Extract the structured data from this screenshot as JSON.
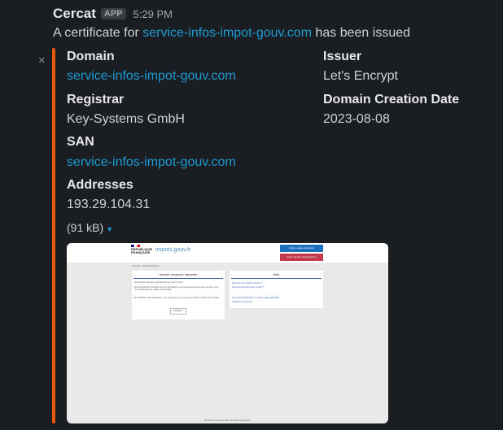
{
  "message": {
    "sender": "Cercat",
    "badge": "APP",
    "time": "5:29 PM",
    "text_before": "A certificate for ",
    "domain_link": "service-infos-impot-gouv.com",
    "text_after": " has been issued"
  },
  "close_symbol": "×",
  "attachment": {
    "fields": {
      "domain_label": "Domain",
      "domain_value": "service-infos-impot-gouv.com",
      "issuer_label": "Issuer",
      "issuer_value": "Let's Encrypt",
      "registrar_label": "Registrar",
      "registrar_value": "Key-Systems GmbH",
      "creation_label": "Domain Creation Date",
      "creation_value": "2023-08-08",
      "san_label": "SAN",
      "san_value": "service-infos-impot-gouv.com",
      "addresses_label": "Addresses",
      "addresses_value": "193.29.104.31"
    },
    "image_size": "(91 kB)",
    "accent_color": "#e8590c",
    "link_color": "#1d9bd1"
  },
  "preview": {
    "rf_text": "RÉPUBLIQUE FRANÇAISE",
    "logo_text": "impots.gouv.fr",
    "button_particulier": "Votre espace particulier",
    "button_professionnel": "Votre espace professionnel",
    "breadcrumb": "Accueil > Authentification",
    "left_card_title": "Activité suspecte détectée",
    "left_card_text1": "Une activité suspecte a été détectée sur votre compte.",
    "left_card_text2": "Afin de garantir la protection de vos informations et de maintenir l'accès à votre compte, nous vous demandons de valider votre identité.",
    "left_card_text3": "En effectuant cette vérification, vous vous assurez que personne d'autre n'utilise votre compte.",
    "left_card_button": "Continuer",
    "right_card_title": "Aide",
    "right_card_links": [
      "Qu'est-ce que l'activité suspecte ?",
      "Comment sécuriser votre compte ?",
      "Les services disponibles sur votre espace particulier",
      "Contacter votre centre"
    ],
    "footer": "Direction générale des Finances publiques"
  }
}
